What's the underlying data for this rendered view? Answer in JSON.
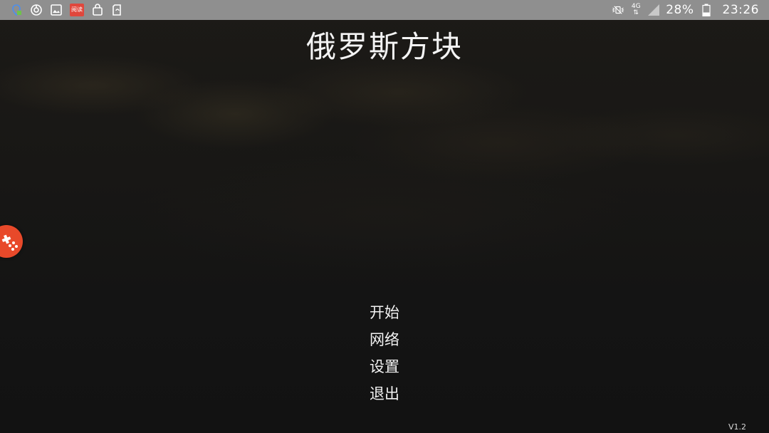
{
  "status_bar": {
    "left_icons": [
      "maps-icon",
      "sync-icon",
      "gallery-icon",
      "read-app-icon",
      "shopping-bag-icon",
      "recycle-icon"
    ],
    "read_badge_label": "阅读",
    "network_label": "4G",
    "battery_percent": "28%",
    "time": "23:26",
    "colors": {
      "background": "#8f8f8f",
      "read_badge": "#e0473c"
    }
  },
  "game": {
    "title": "俄罗斯方块",
    "menu": [
      "开始",
      "网络",
      "设置",
      "退出"
    ],
    "version": "V1.2"
  },
  "floating_button": {
    "icon": "gamepad-icon",
    "color": "#e8492a"
  }
}
